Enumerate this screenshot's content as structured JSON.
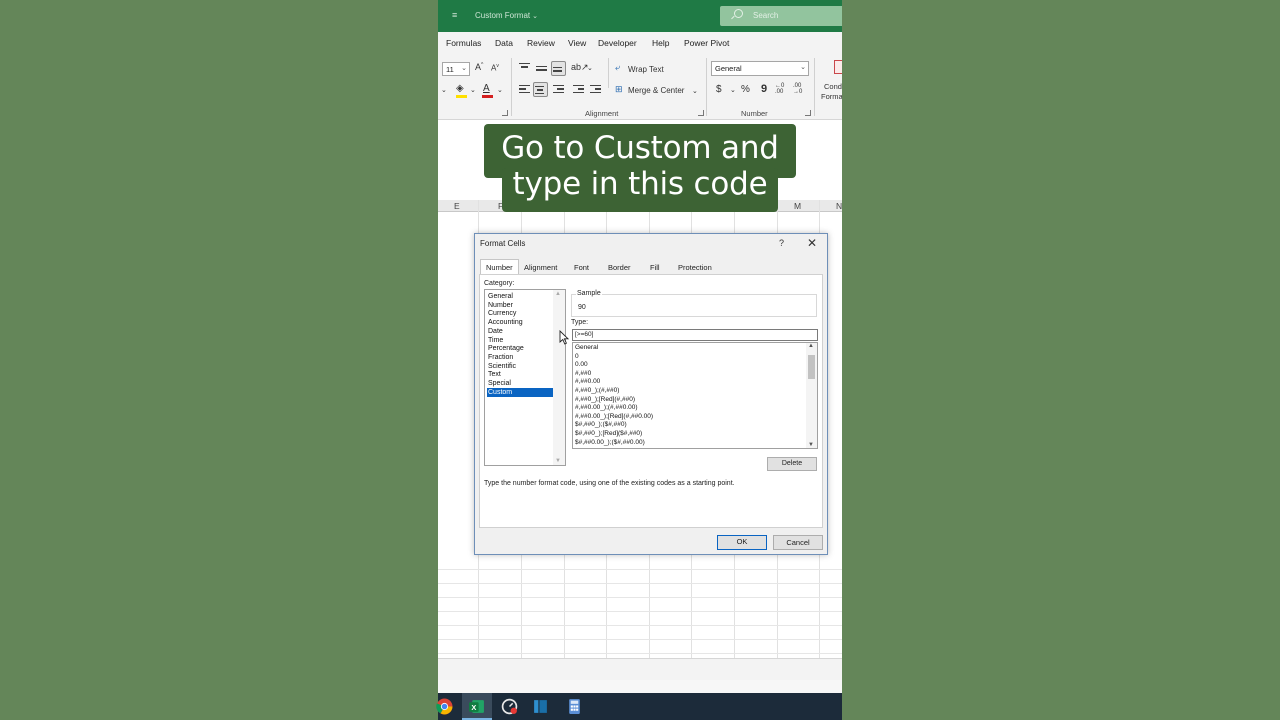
{
  "titlebar": {
    "title": "Custom Format",
    "search_placeholder": "Search"
  },
  "ribbon_tabs": [
    "Formulas",
    "Data",
    "Review",
    "View",
    "Developer",
    "Help",
    "Power Pivot"
  ],
  "ribbon": {
    "font_size": "11",
    "wrap_text": "Wrap Text",
    "merge_center": "Merge & Center",
    "number_format": "General",
    "alignment_label": "Alignment",
    "number_label": "Number",
    "conditional_1": "Cond",
    "conditional_2": "Forma"
  },
  "columns": [
    "E",
    "F",
    "M",
    "N"
  ],
  "caption": {
    "line1": "Go to Custom and",
    "line2": "type in this code"
  },
  "dialog": {
    "title": "Format Cells",
    "help": "?",
    "tabs": [
      "Number",
      "Alignment",
      "Font",
      "Border",
      "Fill",
      "Protection"
    ],
    "category_label": "Category:",
    "categories": [
      "General",
      "Number",
      "Currency",
      "Accounting",
      "Date",
      "Time",
      "Percentage",
      "Fraction",
      "Scientific",
      "Text",
      "Special",
      "Custom"
    ],
    "selected_category": "Custom",
    "sample_label": "Sample",
    "sample_value": "90",
    "type_label": "Type:",
    "type_value": "[>=60]",
    "type_list": [
      "General",
      "0",
      "0.00",
      "#,##0",
      "#,##0.00",
      "#,##0_);(#,##0)",
      "#,##0_);[Red](#,##0)",
      "#,##0.00_);(#,##0.00)",
      "#,##0.00_);[Red](#,##0.00)",
      "$#,##0_);($#,##0)",
      "$#,##0_);[Red]($#,##0)",
      "$#,##0.00_);($#,##0.00)"
    ],
    "delete_label": "Delete",
    "hint": "Type the number format code, using one of the existing codes as a starting point.",
    "ok_label": "OK",
    "cancel_label": "Cancel"
  },
  "colors": {
    "background": "#648659",
    "excel_green": "#1f7a45",
    "caption_bg": "#3d6334",
    "selection": "#0a64c2"
  }
}
